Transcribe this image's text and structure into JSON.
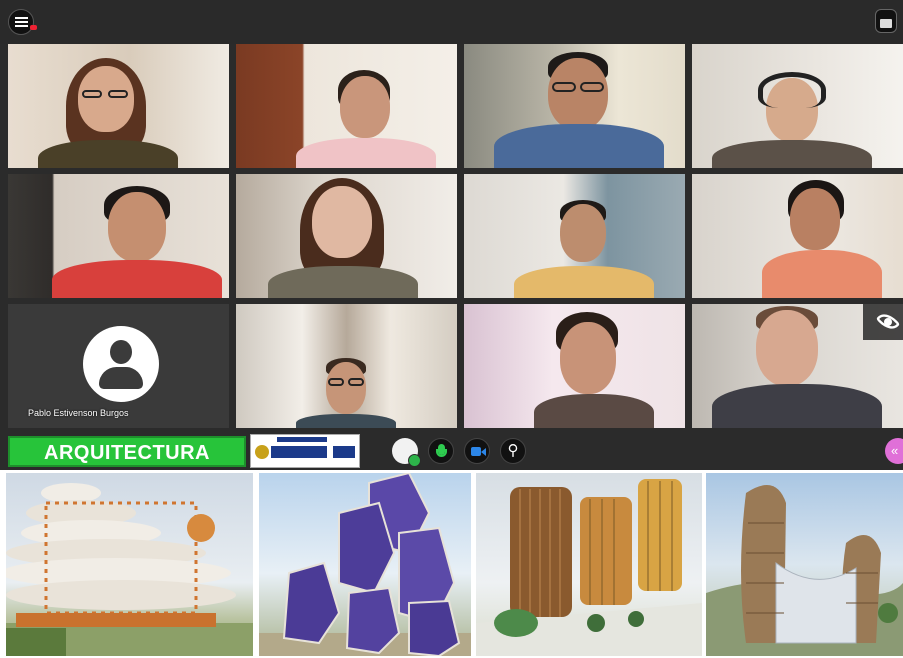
{
  "meeting": {
    "participants": [
      {
        "id": "p1",
        "name": ""
      },
      {
        "id": "p2",
        "name": ""
      },
      {
        "id": "p3",
        "name": ""
      },
      {
        "id": "p4",
        "name": ""
      },
      {
        "id": "p5",
        "name": ""
      },
      {
        "id": "p6",
        "name": ""
      },
      {
        "id": "p7",
        "name": ""
      },
      {
        "id": "p8",
        "name": ""
      },
      {
        "id": "p9",
        "name": "Pablo Estivenson Burgos"
      },
      {
        "id": "p10",
        "name": ""
      },
      {
        "id": "p11",
        "name": ""
      },
      {
        "id": "p12",
        "name": ""
      }
    ]
  },
  "toolbar": {
    "menu_icon": "hamburger-menu-icon",
    "layout_icon": "layout-toggle-icon",
    "visibility_icon": "eye-icon"
  },
  "controls": {
    "banner_text": "ARQUITECTURA BIODIGITAL",
    "status_icon": "user-status-icon",
    "mic_icon": "microphone-icon",
    "camera_icon": "camera-icon",
    "share_icon": "screen-share-icon",
    "share_glyph": "⚲",
    "extra_icon": "more-options-icon",
    "extra_glyph": "«"
  },
  "colors": {
    "banner_green": "#27c43a",
    "mic_green": "#2ecc50",
    "camera_blue": "#2c86e8",
    "accent_pink": "#e070d8",
    "app_background": "#2b2b2b"
  }
}
